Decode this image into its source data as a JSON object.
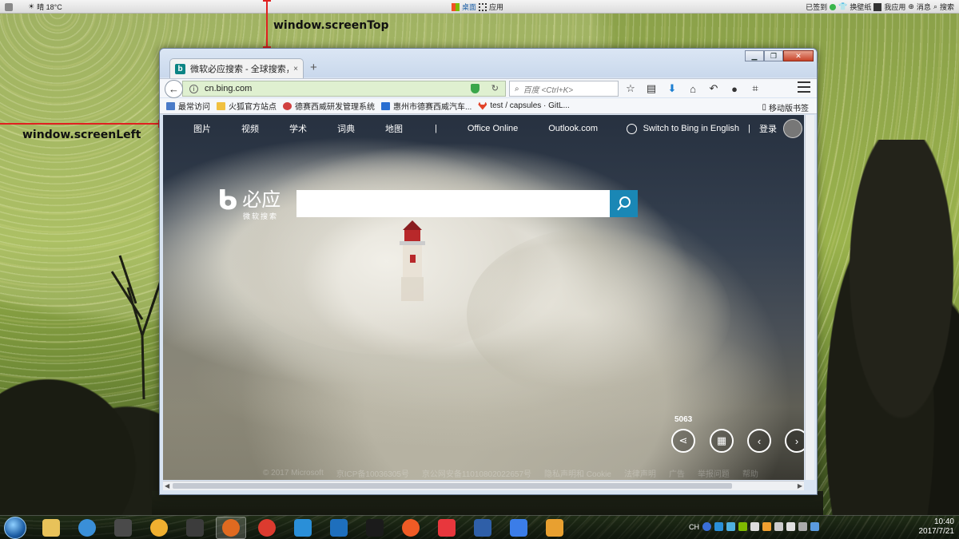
{
  "topbar": {
    "weather": "晴 18°C",
    "center_items": [
      {
        "label": "桌面",
        "icon": "windows-flag-icon"
      },
      {
        "label": "应用",
        "icon": "apps-grid-icon"
      }
    ],
    "right_items": [
      {
        "label": "已签到",
        "icon": "green-dot-icon"
      },
      {
        "label": "换壁纸",
        "icon": "shirt-icon"
      },
      {
        "label": "我应用",
        "icon": "app-badge-icon"
      },
      {
        "label": "消息",
        "icon": "globe-icon"
      },
      {
        "label": "搜索",
        "icon": "search-icon"
      }
    ]
  },
  "annotations": {
    "screen_top": "window.screenTop",
    "screen_left": "window.screenLeft",
    "color": "#e02020"
  },
  "browser": {
    "tab_title": "微软必应搜索 - 全球搜索，有",
    "tab_close": "×",
    "new_tab": "+",
    "url": "cn.bing.com",
    "search_placeholder": "百度 <Ctrl+K>",
    "bookmarks": [
      {
        "label": "最常访问",
        "icon": "bookmark-folder-icon",
        "color": "#4a7bc8"
      },
      {
        "label": "火狐官方站点",
        "icon": "folder-icon",
        "color": "#f0c040"
      },
      {
        "label": "德赛西威研发管理系统",
        "icon": "desay-icon",
        "color": "#d04040"
      },
      {
        "label": "惠州市德赛西威汽车...",
        "icon": "desay-blue-icon",
        "color": "#2a6fd1"
      },
      {
        "label": "test / capsules · GitL...",
        "icon": "gitlab-icon",
        "color": "#e24329"
      }
    ],
    "mobile_bookmarks": "移动版书签"
  },
  "bing": {
    "nav": [
      "图片",
      "视频",
      "学术",
      "词典",
      "地图"
    ],
    "nav_extra": [
      "Office Online",
      "Outlook.com"
    ],
    "switch_english": "Switch to Bing in English",
    "login": "登录",
    "logo_text": "必应",
    "logo_sub": "微软搜索",
    "search_value": "",
    "counter": "5063",
    "footer": [
      "© 2017 Microsoft",
      "京ICP备10036305号",
      "京公网安备11010802022657号",
      "隐私声明和 Cookie",
      "法律声明",
      "广告",
      "举报问题",
      "帮助"
    ],
    "accent": "#1a87b5"
  },
  "taskbar": {
    "apps": [
      {
        "name": "file-explorer",
        "color": "#e8c25a"
      },
      {
        "name": "internet-explorer",
        "color": "#3a8fd8"
      },
      {
        "name": "sublime-text",
        "color": "#4a4a4a"
      },
      {
        "name": "paint-palette",
        "color": "#f0b030"
      },
      {
        "name": "terminal",
        "color": "#3c3c3c"
      },
      {
        "name": "firefox",
        "color": "#e06a20"
      },
      {
        "name": "chrome",
        "color": "#dc3b2f"
      },
      {
        "name": "qq-browser",
        "color": "#2a8fd8"
      },
      {
        "name": "visual-studio-code",
        "color": "#1e6fbd"
      },
      {
        "name": "webstorm",
        "color": "#1b1b1b"
      },
      {
        "name": "postman",
        "color": "#ef5b25"
      },
      {
        "name": "xmind",
        "color": "#e8373d"
      },
      {
        "name": "remote-desktop",
        "color": "#2f5fa8"
      },
      {
        "name": "feishu-doc",
        "color": "#3b7de8"
      },
      {
        "name": "mail-client",
        "color": "#e8a030"
      }
    ],
    "tray_lang": "CH",
    "time": "10:40",
    "date": "2017/7/21"
  }
}
